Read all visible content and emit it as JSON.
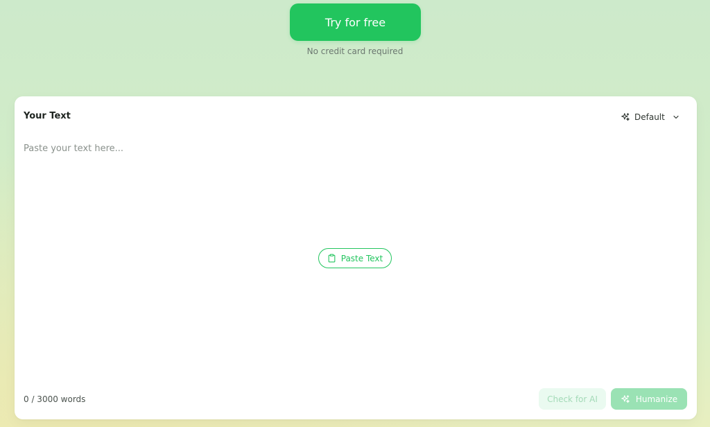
{
  "hero": {
    "cta_label": "Try for free",
    "cta_subtext": "No credit card required"
  },
  "editor": {
    "title": "Your Text",
    "mode": {
      "selected": "Default",
      "icon": "sparkle-icon"
    },
    "textarea": {
      "value": "",
      "placeholder": "Paste your text here..."
    },
    "paste_button_label": "Paste Text",
    "paste_icon": "clipboard-icon",
    "word_count": "0 / 3000 words",
    "check_button_label": "Check for AI",
    "humanize_button_label": "Humanize"
  },
  "colors": {
    "accent": "#22c55e",
    "accent_disabled": "#9ae2b4",
    "check_disabled_bg": "#eafaf0"
  }
}
